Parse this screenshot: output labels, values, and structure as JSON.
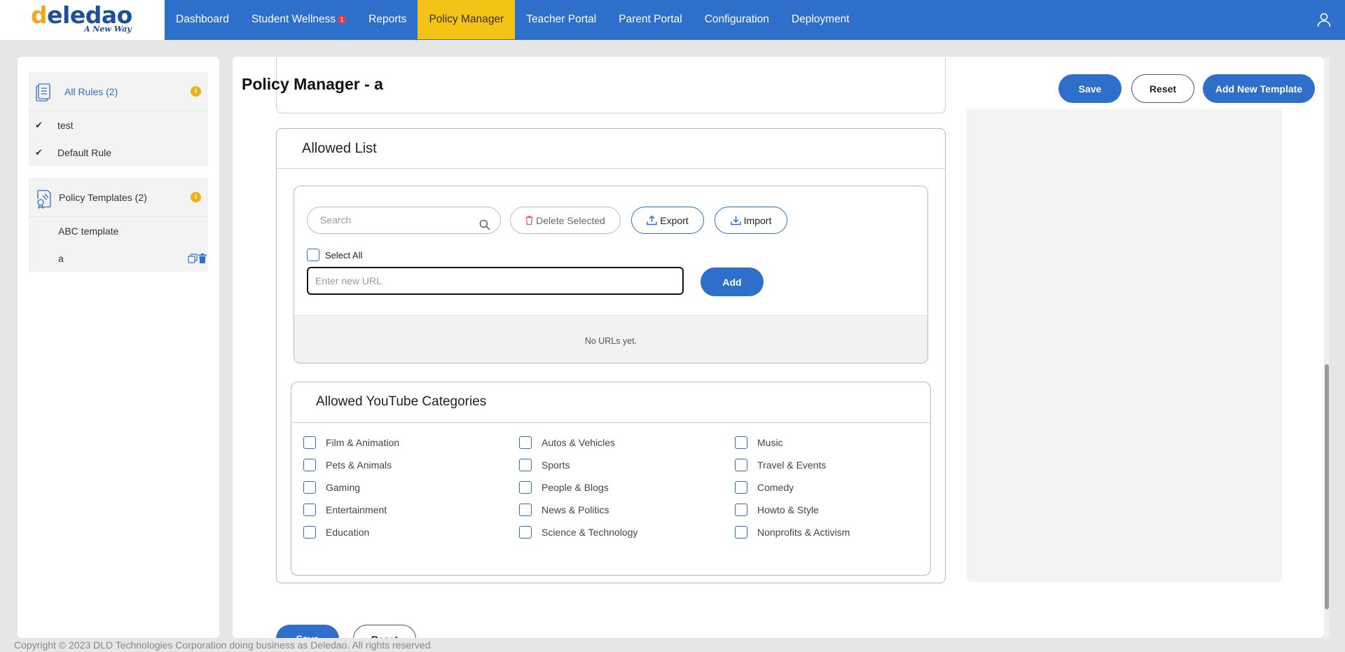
{
  "brand": {
    "name": "deledao",
    "tagline": "A New Way"
  },
  "nav": {
    "items": [
      {
        "label": "Dashboard"
      },
      {
        "label": "Student Wellness",
        "badge": "1"
      },
      {
        "label": "Reports"
      },
      {
        "label": "Policy Manager",
        "active": true
      },
      {
        "label": "Teacher Portal"
      },
      {
        "label": "Parent Portal"
      },
      {
        "label": "Configuration"
      },
      {
        "label": "Deployment"
      }
    ],
    "user_icon": "user-icon"
  },
  "sidebar": {
    "rules": {
      "title": "All Rules (2)",
      "info": "i",
      "items": [
        {
          "label": "test"
        },
        {
          "label": "Default Rule"
        }
      ]
    },
    "templates": {
      "title": "Policy Templates (2)",
      "info": "i",
      "items": [
        {
          "label": "ABC template"
        },
        {
          "label": "a"
        }
      ]
    }
  },
  "main": {
    "title": "Policy Manager - a",
    "buttons": {
      "save": "Save",
      "reset": "Reset",
      "add_template": "Add New Template"
    },
    "allowed_list": {
      "title": "Allowed List",
      "search_placeholder": "Search",
      "delete_selected": "Delete Selected",
      "export": "Export",
      "import": "Import",
      "select_all": "Select All",
      "url_placeholder": "Enter new URL",
      "add": "Add",
      "empty_text": "No URLs yet."
    },
    "youtube": {
      "title": "Allowed YouTube Categories",
      "categories": [
        "Film & Animation",
        "Autos & Vehicles",
        "Music",
        "Pets & Animals",
        "Sports",
        "Travel & Events",
        "Gaming",
        "People & Blogs",
        "Comedy",
        "Entertainment",
        "News & Politics",
        "Howto & Style",
        "Education",
        "Science & Technology",
        "Nonprofits & Activism"
      ]
    },
    "bottom_buttons": {
      "save": "Save",
      "reset": "Reset"
    }
  },
  "footer": "Copyright © 2023 DLD Technologies Corporation doing business as Deledao. All rights reserved.",
  "colors": {
    "primary": "#2e6fcb",
    "active_tab": "#f5c316",
    "info": "#e8b21c"
  }
}
